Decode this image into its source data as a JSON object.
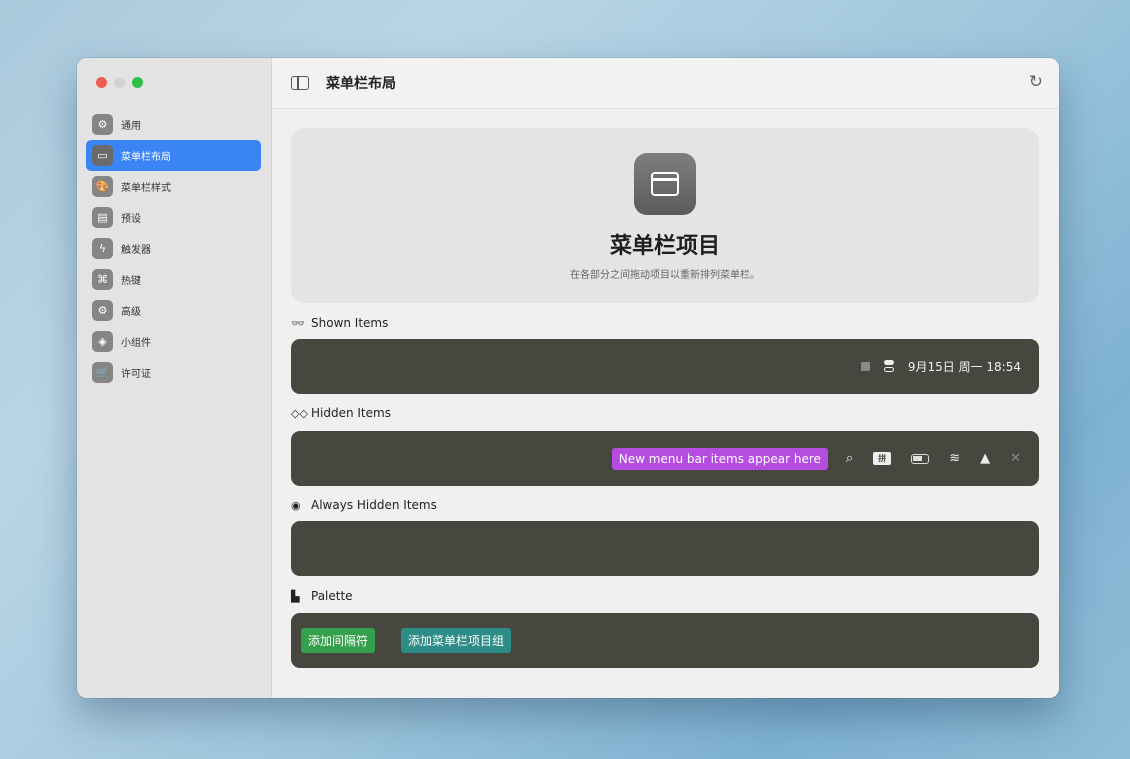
{
  "window": {
    "title": "菜单栏布局"
  },
  "sidebar": {
    "items": [
      {
        "label": "通用",
        "icon": "gear-icon",
        "glyph": "⚙"
      },
      {
        "label": "菜单栏布局",
        "icon": "menubar-layout-icon",
        "glyph": "▭",
        "active": true
      },
      {
        "label": "菜单栏样式",
        "icon": "palette-icon",
        "glyph": "🎨"
      },
      {
        "label": "预设",
        "icon": "preset-icon",
        "glyph": "▤"
      },
      {
        "label": "触发器",
        "icon": "bolt-icon",
        "glyph": "ϟ"
      },
      {
        "label": "热键",
        "icon": "hotkey-icon",
        "glyph": "⌘"
      },
      {
        "label": "高级",
        "icon": "gears-icon",
        "glyph": "⚙"
      },
      {
        "label": "小组件",
        "icon": "widget-icon",
        "glyph": "◈"
      },
      {
        "label": "许可证",
        "icon": "cart-icon",
        "glyph": "🛒"
      }
    ]
  },
  "hero": {
    "title": "菜单栏项目",
    "subtitle": "在各部分之间拖动项目以重新排列菜单栏。"
  },
  "sections": {
    "shown": {
      "label": "Shown Items",
      "icon_glyph": "👓",
      "clock": "9月15日 周一  18:54"
    },
    "hidden": {
      "label": "Hidden Items",
      "icon_glyph": "◇◇",
      "badge": "New menu bar items appear here",
      "pin_label": "拼"
    },
    "always_hidden": {
      "label": "Always Hidden Items",
      "icon_glyph": "◉"
    },
    "palette": {
      "label": "Palette",
      "icon_glyph": "▙",
      "buttons": [
        "添加间隔符",
        "添加菜单栏项目组"
      ]
    }
  },
  "colors": {
    "accent": "#3b84f5",
    "bar_bg": "#474740",
    "badge_purple": "#b44de0",
    "palette_green": "#35a04c",
    "palette_teal": "#2c8c86"
  }
}
